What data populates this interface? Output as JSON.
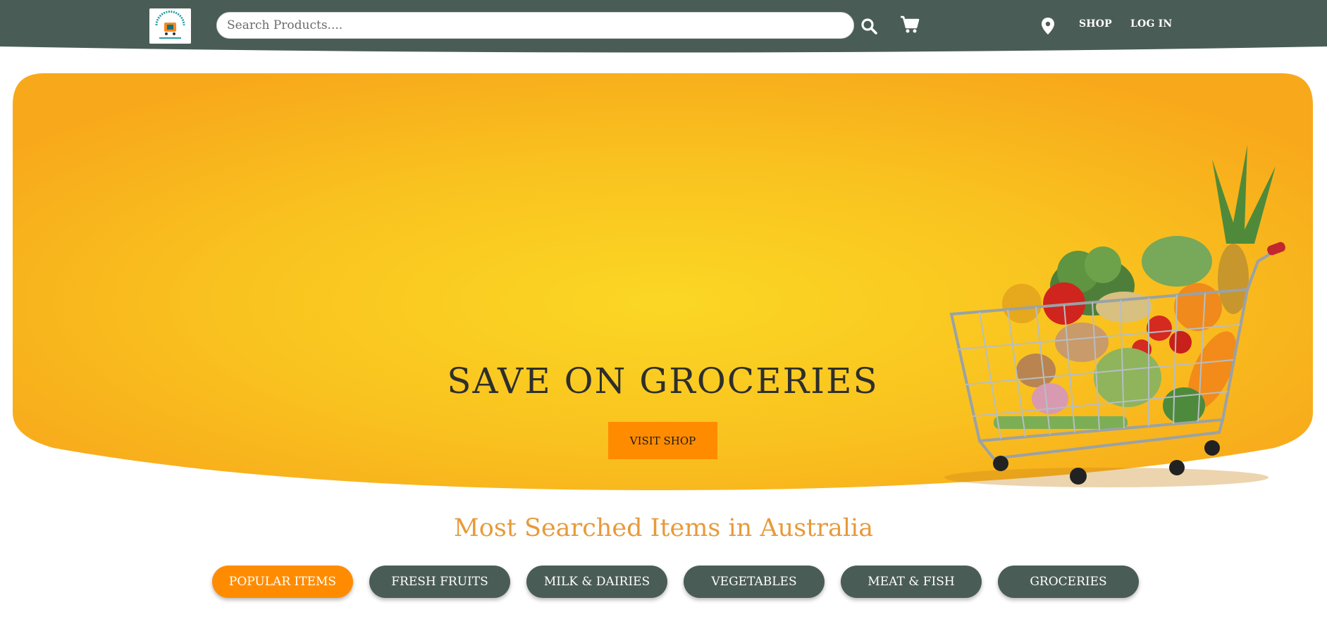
{
  "header": {
    "search_placeholder": "Search Products....",
    "nav": {
      "shop": "SHOP",
      "login": "LOG IN"
    },
    "icons": {
      "search": "search-icon",
      "cart": "cart-icon",
      "location": "location-pin-icon"
    }
  },
  "hero": {
    "title": "SAVE ON GROCERIES",
    "button_label": "VISIT SHOP"
  },
  "section": {
    "title": "Most Searched Items in Australia",
    "tabs": [
      {
        "label": "POPULAR ITEMS",
        "active": true
      },
      {
        "label": "FRESH FRUITS",
        "active": false
      },
      {
        "label": "MILK & DAIRIES",
        "active": false
      },
      {
        "label": "VEGETABLES",
        "active": false
      },
      {
        "label": "MEAT & FISH",
        "active": false
      },
      {
        "label": "GROCERIES",
        "active": false
      }
    ]
  },
  "colors": {
    "header_bg": "#4a5c56",
    "hero_center": "#fbd724",
    "hero_edge": "#f8a91b",
    "accent_orange": "#ff8c00",
    "section_title": "#e79a3a",
    "tab_bg": "#4a5c56"
  }
}
